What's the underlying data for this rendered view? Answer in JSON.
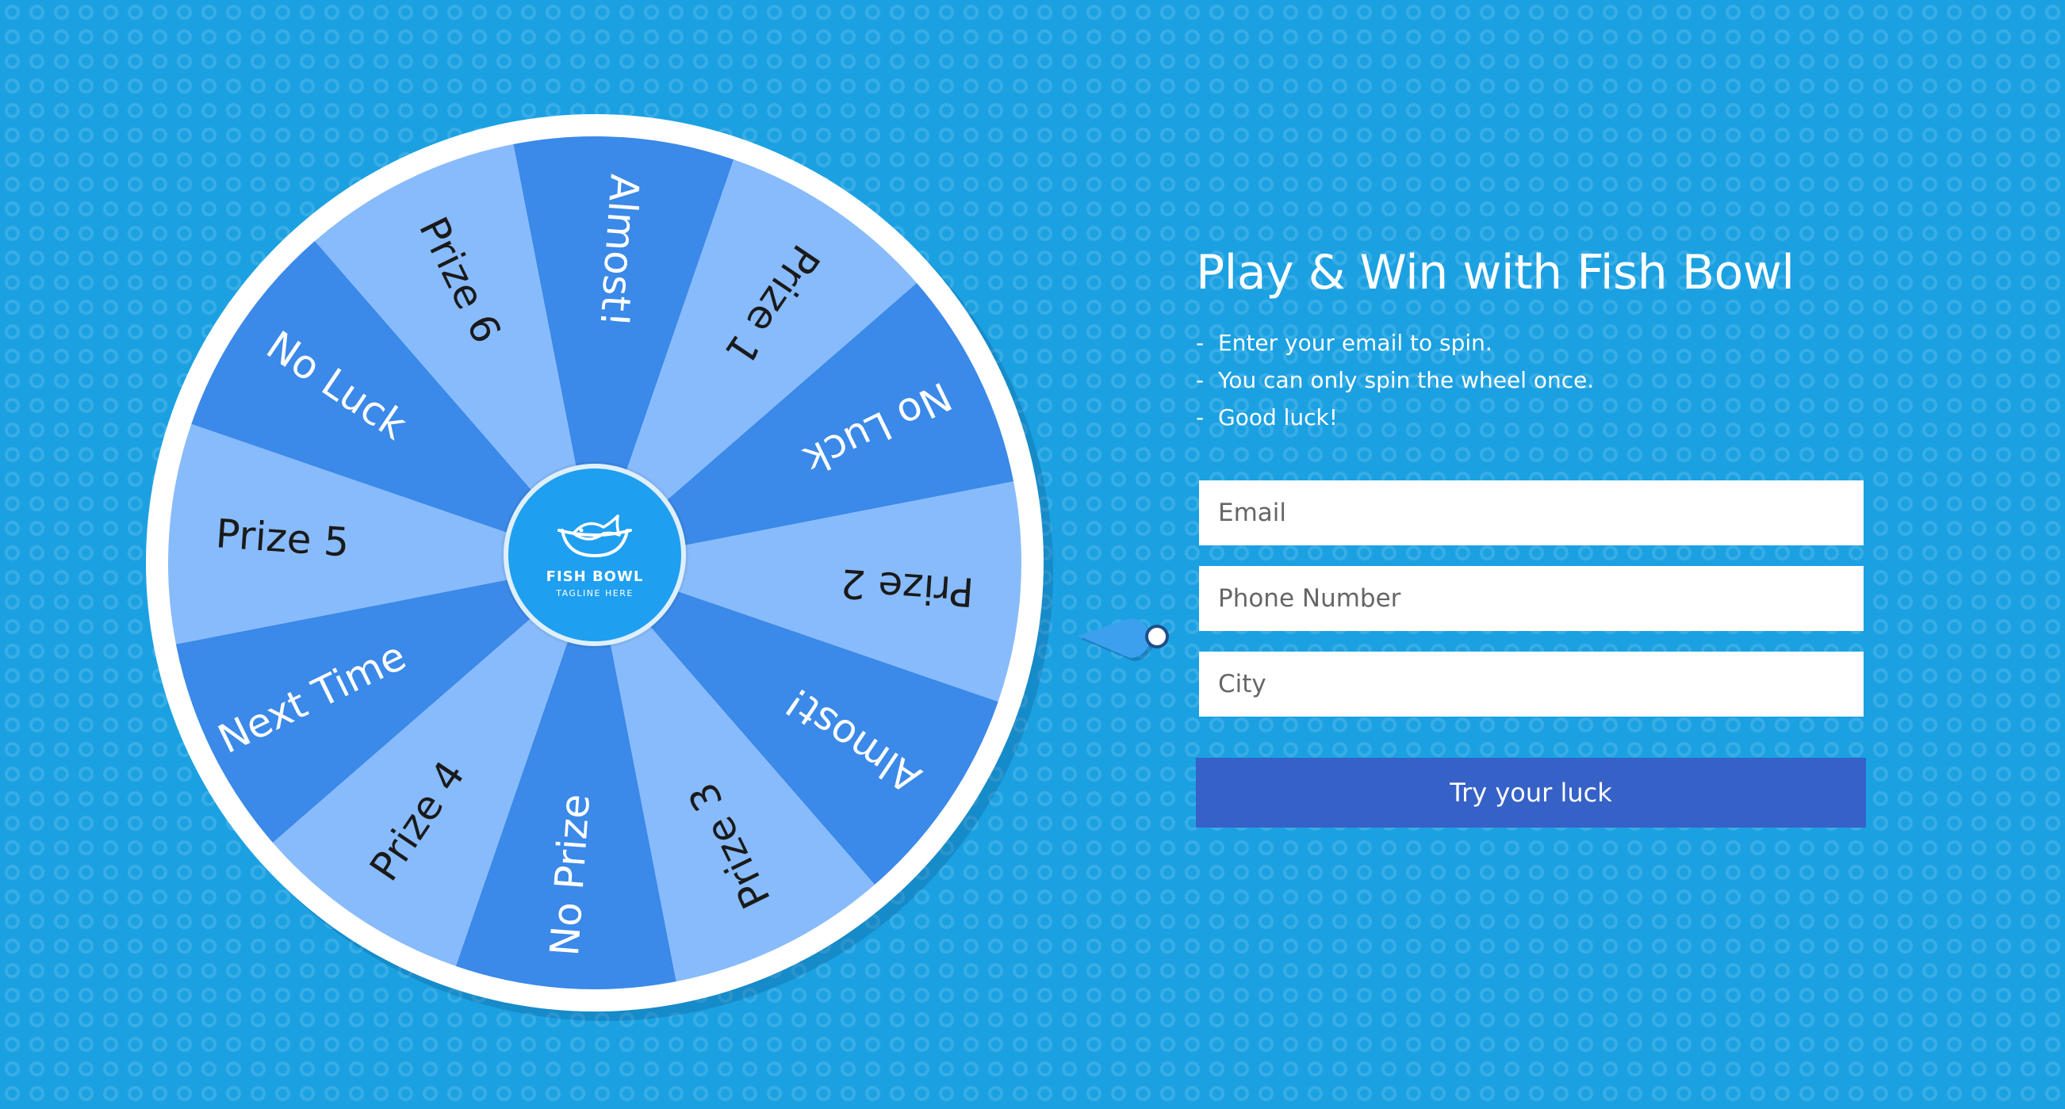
{
  "wheel": {
    "slices": [
      {
        "label": "Almost!",
        "color": "#3b89e8",
        "text_color": "#ffffff"
      },
      {
        "label": "Prize 1",
        "color": "#88bbfb",
        "text_color": "#1a1a1a"
      },
      {
        "label": "No Luck",
        "color": "#3b89e8",
        "text_color": "#ffffff"
      },
      {
        "label": "Prize 2",
        "color": "#88bbfb",
        "text_color": "#1a1a1a"
      },
      {
        "label": "Almost!",
        "color": "#3b89e8",
        "text_color": "#ffffff"
      },
      {
        "label": "Prize 3",
        "color": "#88bbfb",
        "text_color": "#1a1a1a"
      },
      {
        "label": "No Prize",
        "color": "#3b89e8",
        "text_color": "#ffffff"
      },
      {
        "label": "Prize 4",
        "color": "#88bbfb",
        "text_color": "#1a1a1a"
      },
      {
        "label": "Next Time",
        "color": "#3b89e8",
        "text_color": "#ffffff"
      },
      {
        "label": "Prize 5",
        "color": "#88bbfb",
        "text_color": "#1a1a1a"
      },
      {
        "label": "No Luck",
        "color": "#3b89e8",
        "text_color": "#ffffff"
      },
      {
        "label": "Prize 6",
        "color": "#88bbfb",
        "text_color": "#1a1a1a"
      }
    ],
    "hub": {
      "brand": "FISH BOWL",
      "tagline": "TAGLINE HERE",
      "icon": "fish-bowl-logo-icon"
    },
    "pointer_icon": "wheel-pointer-icon",
    "rim_color": "#ffffff",
    "hub_color": "#1f9ff0"
  },
  "form": {
    "title": "Play & Win with Fish Bowl",
    "instructions": [
      "Enter your email to spin.",
      "You can only spin the wheel once.",
      "Good luck!"
    ],
    "email_placeholder": "Email",
    "phone_placeholder": "Phone Number",
    "city_placeholder": "City",
    "submit_label": "Try your luck",
    "button_color": "#3661c7"
  },
  "background_color": "#1ba1e2"
}
